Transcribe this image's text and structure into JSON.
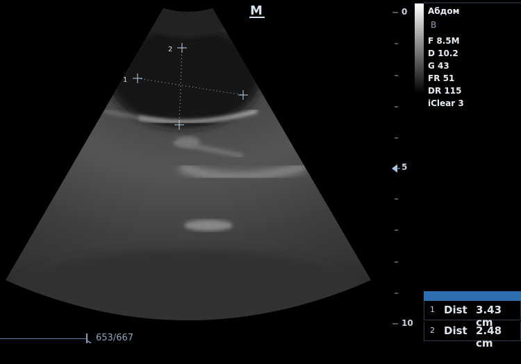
{
  "mode_label": "M",
  "preset": "Абдом",
  "mode": "B",
  "params": [
    "F 8.5M",
    "D 10.2",
    "G 43",
    "FR 51",
    "DR 115",
    "iClear 3"
  ],
  "depth_scale": {
    "labels": [
      "0",
      "5",
      "10"
    ],
    "focus_marker": "focus-triangle-icon"
  },
  "caliper_labels": [
    "1",
    "2"
  ],
  "measurements": [
    {
      "index": "1",
      "name": "Dist",
      "value": "3.43 cm"
    },
    {
      "index": "2",
      "name": "Dist",
      "value": "2.48 cm"
    }
  ],
  "cine": {
    "counter": "653/667"
  },
  "colors": {
    "accent": "#2d6fb1",
    "caliper": "#9ec3e6",
    "text": "#e9eef3"
  }
}
